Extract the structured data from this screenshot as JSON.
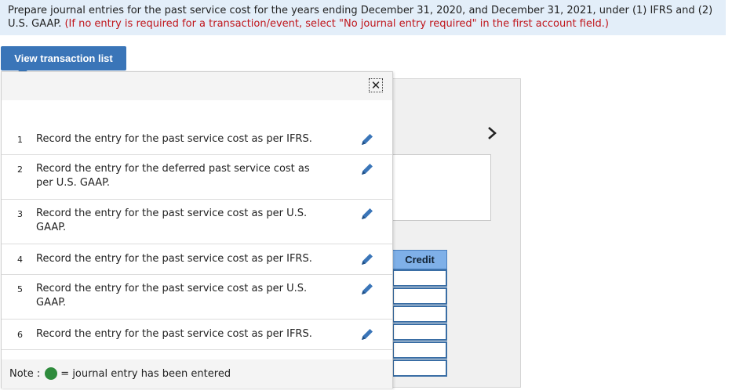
{
  "instructions": {
    "text": "Prepare journal entries for the past service cost for the years ending December 31, 2020, and December 31, 2021, under (1) IFRS and (2) U.S. GAAP.",
    "note": "(If no entry is required for a transaction/event, select \"No journal entry required\" in the first account field.)"
  },
  "toolbar": {
    "view_transaction_list": "View transaction list"
  },
  "popup": {
    "close_symbol": "✕",
    "transactions": [
      {
        "num": "1",
        "text": "Record the entry for the past service cost as per IFRS."
      },
      {
        "num": "2",
        "text": "Record the entry for the deferred past service cost as per U.S. GAAP."
      },
      {
        "num": "3",
        "text": "Record the entry for the past service cost as per U.S. GAAP."
      },
      {
        "num": "4",
        "text": "Record the entry for the past service cost as per IFRS."
      },
      {
        "num": "5",
        "text": "Record the entry for the past service cost as per U.S. GAAP."
      },
      {
        "num": "6",
        "text": "Record the entry for the past service cost as per IFRS."
      }
    ],
    "legend": {
      "prefix": "Note :",
      "suffix": "= journal entry has been entered"
    }
  },
  "journal": {
    "credit_header": "Credit",
    "next_symbol": "›"
  },
  "colors": {
    "accent": "#3a75b8",
    "note_red": "#c0151b",
    "entered_green": "#2e8b3c",
    "header_blue": "#7fb0e8"
  },
  "icons": {
    "edit": "pencil-icon",
    "close": "close-icon",
    "next": "chevron-right-icon",
    "entered": "green-dot-icon"
  }
}
